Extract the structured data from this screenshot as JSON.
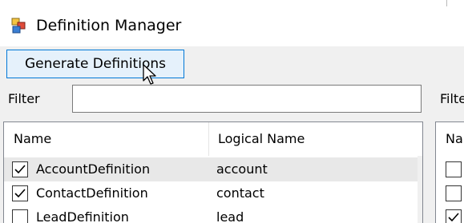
{
  "window": {
    "title": "Definition Manager",
    "icon": "app-icon"
  },
  "toolbar": {
    "generate_label": "Generate Definitions"
  },
  "filter": {
    "label": "Filter",
    "value": "",
    "right_label": "Filte"
  },
  "left_grid": {
    "columns": [
      "Name",
      "Logical Name"
    ],
    "rows": [
      {
        "name": "AccountDefinition",
        "logical": "account",
        "checked": true,
        "selected": true
      },
      {
        "name": "ContactDefinition",
        "logical": "contact",
        "checked": true,
        "selected": false
      },
      {
        "name": "LeadDefinition",
        "logical": "lead",
        "checked": false,
        "selected": false
      }
    ]
  },
  "right_grid": {
    "header": "Na",
    "checks": [
      false,
      false,
      true
    ]
  }
}
